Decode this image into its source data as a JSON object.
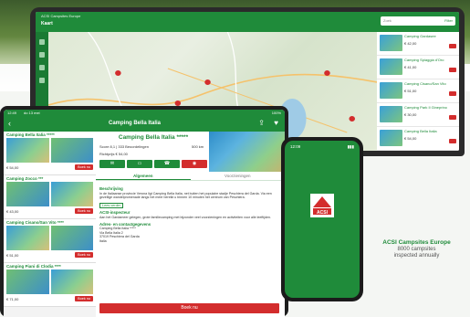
{
  "laptop": {
    "window_title": "ACSI Campsites Europe",
    "header": "Kaart",
    "search_placeholder": "Zoek",
    "filter_label": "Filter",
    "panel_items": [
      {
        "name": "Camping Gardasee",
        "price": "€ 42,00"
      },
      {
        "name": "Camping Spiaggia d'Oro",
        "price": "€ 41,00"
      },
      {
        "name": "Camping Cisano/San Vito",
        "price": "€ 51,00"
      },
      {
        "name": "Camping Park Il Gineprino",
        "price": "€ 30,00"
      },
      {
        "name": "Camping Bella Italia",
        "price": "€ 54,00"
      }
    ]
  },
  "tablet": {
    "status_time": "12:49",
    "status_date": "do 13 mei",
    "status_battery": "100%",
    "bar_title": "Camping Bella Italia",
    "list": [
      {
        "name": "Camping Bella Italia *****",
        "price": "€ 54,00",
        "book": "Boek nu"
      },
      {
        "name": "Camping Zocco ***",
        "price": "€ 43,00",
        "book": "Boek nu"
      },
      {
        "name": "Camping Cisano/San Vito ****",
        "price": "€ 51,00",
        "book": "Boek nu"
      },
      {
        "name": "Camping Piani di Clodia ****",
        "price": "€ 71,00",
        "book": "Boek nu"
      }
    ],
    "detail": {
      "title": "Camping Bella Italia *****",
      "address": "Score 8,1 | 333 Beoordelingen",
      "distance": "500 km",
      "rate": "Richtprijs € 54,00",
      "tab_general": "Algemeen",
      "tab_facilities": "Voorzieningen",
      "section_description": "Beschrijving",
      "description": "In de Italiaanse provincie Verona ligt Camping Bella Italia, net buiten het populaire stadje Peschiera del Garda. Via een gezellige wandelpromenade langs het meer bereikt u binnen 10 minuten het centrum van Peschiera.",
      "read_more": "Lees verder",
      "section_inspection": "ACSI-inspecteur",
      "inspection": "Aan het Gardameer gelegen, grote familiecamping met bijzonder veel voorzieningen en activiteiten voor alle leeftijden.",
      "section_address": "Adres- en contactgegevens",
      "contact_name": "Camping Bella Italia *****",
      "contact_street": "Via Bella Italia 2",
      "contact_city": "37019 Peschiera del Garda",
      "contact_country": "Italia",
      "book_label": "Boek nu"
    }
  },
  "phone": {
    "time": "12:09",
    "logo_text": "ACSI"
  },
  "promo": {
    "title": "ACSI Campsites Europe",
    "line1": "8000 campsites",
    "line2": "inspected annually"
  },
  "colors": {
    "brand_green": "#1f8b3a",
    "book_red": "#d32d2d"
  }
}
